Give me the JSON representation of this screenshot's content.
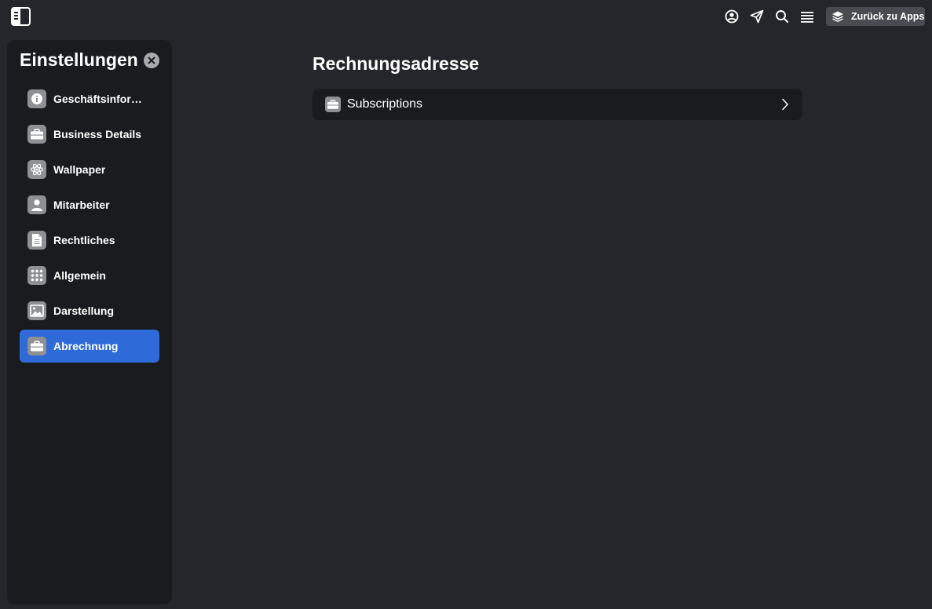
{
  "topbar": {
    "icons": [
      "sidebar-toggle-icon",
      "user-circle-icon",
      "send-icon",
      "search-icon",
      "menu-icon"
    ],
    "back_button_label": "Zurück zu Apps",
    "back_button_icon": "layers-icon"
  },
  "sidebar": {
    "title": "Einstellungen",
    "close_icon": "close-icon",
    "active_color": "#2f6bd8",
    "items": [
      {
        "label": "Geschäftsinformationen",
        "icon": "info-icon",
        "active": false
      },
      {
        "label": "Business Details",
        "icon": "briefcase-icon",
        "active": false
      },
      {
        "label": "Wallpaper",
        "icon": "atom-icon",
        "active": false
      },
      {
        "label": "Mitarbeiter",
        "icon": "person-icon",
        "active": false
      },
      {
        "label": "Rechtliches",
        "icon": "document-icon",
        "active": false
      },
      {
        "label": "Allgemein",
        "icon": "grid-icon",
        "active": false
      },
      {
        "label": "Darstellung",
        "icon": "image-icon",
        "active": false
      },
      {
        "label": "Abrechnung",
        "icon": "briefcase-icon",
        "active": true
      }
    ]
  },
  "main": {
    "title": "Rechnungsadresse",
    "rows": [
      {
        "label": "Subscriptions",
        "icon": "briefcase-icon"
      }
    ]
  }
}
